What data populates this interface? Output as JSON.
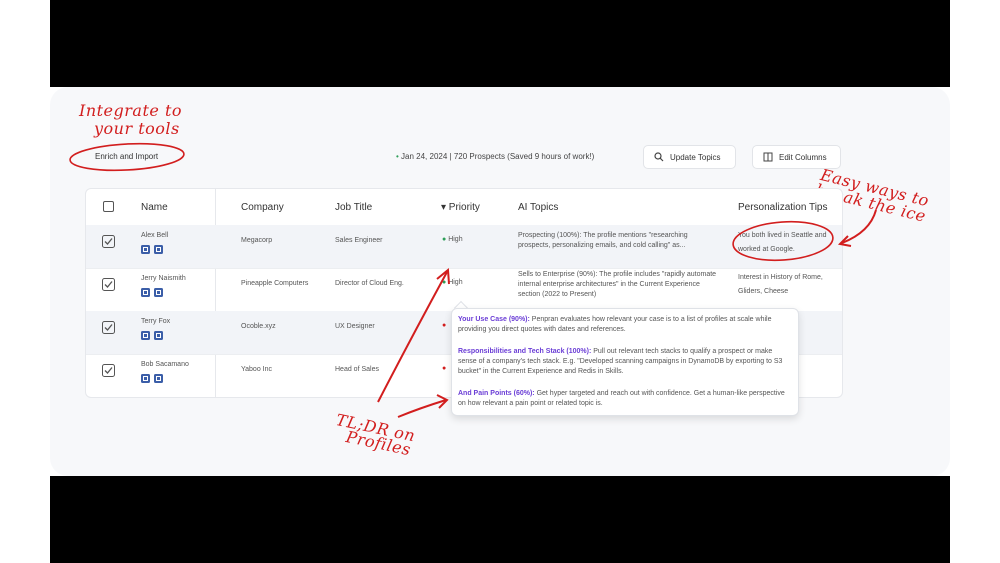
{
  "annotations": {
    "integrate_line1": "Integrate to",
    "integrate_line2": "your tools",
    "easy_line1": "Easy ways to",
    "easy_line2": "break the ice",
    "tldr_line1": "TL;DR on",
    "tldr_line2": "Profiles"
  },
  "toolbar": {
    "enrich_label": "Enrich and Import",
    "stats": "Jan 24, 2024 | 720 Prospects (Saved 9 hours of work!)",
    "update_topics": "Update Topics",
    "edit_columns": "Edit Columns"
  },
  "table": {
    "headers": {
      "name": "Name",
      "company": "Company",
      "job_title": "Job Title",
      "priority": "▾ Priority",
      "ai_topics": "AI Topics",
      "tips": "Personalization Tips"
    },
    "rows": [
      {
        "name": "Alex Bell",
        "company": "Megacorp",
        "job": "Sales Engineer",
        "priority": "High",
        "ai": "Prospecting (100%): The profile mentions \"researching prospects, personalizing emails, and cold calling\" as...",
        "tip": "You both lived in Seattle and worked at Google."
      },
      {
        "name": "Jerry Naismith",
        "company": "Pineapple Computers",
        "job": "Director of Cloud Eng.",
        "priority": "High",
        "ai": "Sells to Enterprise (90%): The profile includes \"rapidly automate internal enterprise architectures\" in the Current Experience section (2022 to Present)",
        "tip": "Interest in History of Rome, Gliders, Cheese"
      },
      {
        "name": "Terry Fox",
        "company": "Ocoble.xyz",
        "job": "UX Designer",
        "priority": "",
        "ai": "",
        "tip": ""
      },
      {
        "name": "Bob Sacamano",
        "company": "Yaboo Inc",
        "job": "Head of Sales",
        "priority": "",
        "ai": "",
        "tip": ""
      }
    ]
  },
  "popover": {
    "item1_title": "Your Use Case (90%):",
    "item1_text": " Penpran evaluates how relevant your case is to a list of profiles at scale while providing you direct quotes with dates and references.",
    "item2_title": "Responsibilities and Tech Stack (100%):",
    "item2_text": " Pull out relevant tech stacks to qualify a prospect or make sense of a company's tech stack. E.g. \"Developed scanning campaigns in DynamoDB by exporting to S3 bucket\" in the Current Experience and Redis in Skills.",
    "item3_title": "And Pain Points (60%):",
    "item3_text": " Get hyper targeted and reach out with confidence. Get a human-like perspective on how relevant a pain point or related topic is."
  },
  "colors": {
    "accent_red": "#d21e1e",
    "popover_title": "#6b3ed6",
    "status_green": "#2e9e58",
    "linkedin_blue": "#3b5ea8"
  }
}
